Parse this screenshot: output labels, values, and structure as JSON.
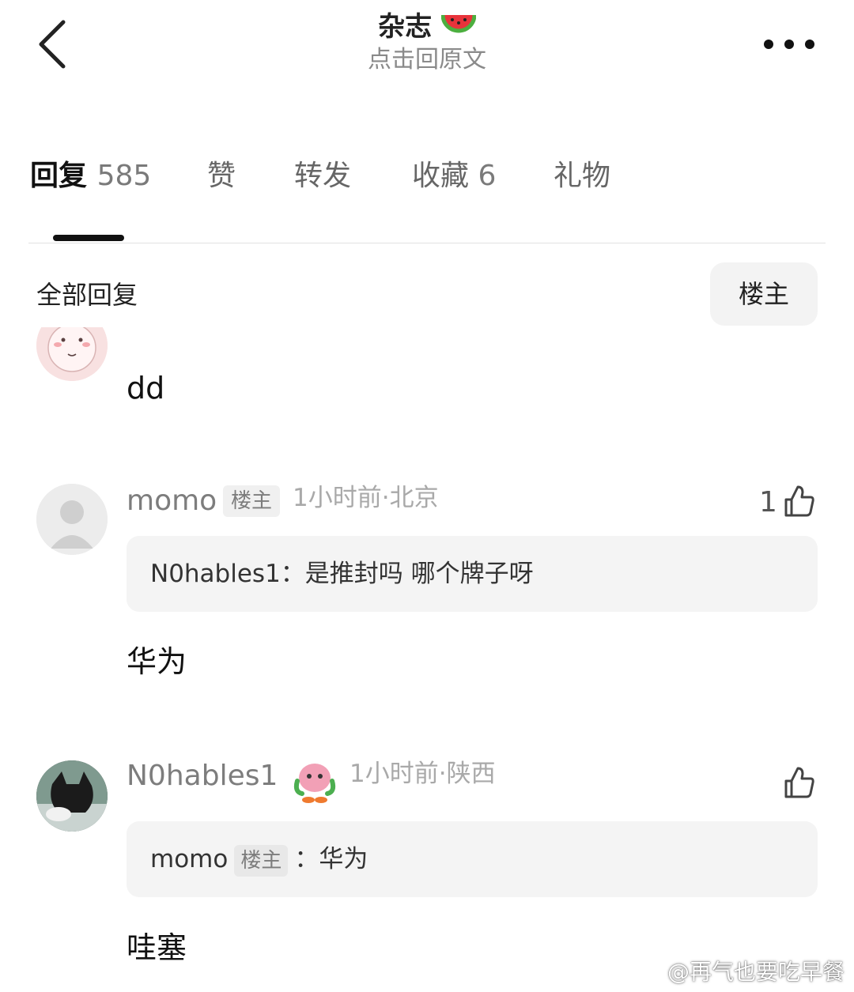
{
  "header": {
    "title": "杂志",
    "title_emoji": "watermelon-emoji",
    "subtitle": "点击回原文",
    "back_icon": "chevron-left-icon",
    "more_icon": "more-dots-icon"
  },
  "tabs": [
    {
      "label": "回复",
      "count": "585",
      "active": true
    },
    {
      "label": "赞",
      "count": ""
    },
    {
      "label": "转发",
      "count": ""
    },
    {
      "label": "收藏",
      "count": "6"
    },
    {
      "label": "礼物",
      "count": ""
    }
  ],
  "filter": {
    "label": "全部回复",
    "owner_button": "楼主"
  },
  "comments": [
    {
      "avatar": "pink-cartoon-avatar",
      "body": "dd"
    },
    {
      "avatar": "default-gray-avatar",
      "username": "momo",
      "badge": "楼主",
      "meta": "1小时前·北京",
      "likes": "1",
      "quote": {
        "name": "N0hables1",
        "separator": "：",
        "text": "是推封吗 哪个牌子呀"
      },
      "body": "华为"
    },
    {
      "avatar": "wolf-photo-avatar",
      "username": "N0hables1",
      "sticker": "pink-creature-sticker",
      "meta": "1小时前·陕西",
      "likes": "",
      "quote": {
        "name": "momo",
        "badge": "楼主",
        "separator": "：",
        "text": "华为"
      },
      "body": "哇塞"
    }
  ],
  "watermark": "@再气也要吃早餐",
  "colors": {
    "text_primary": "#111111",
    "text_secondary": "#7d7d7d",
    "meta": "#a9a9a9",
    "quote_bg": "#f4f4f4"
  }
}
